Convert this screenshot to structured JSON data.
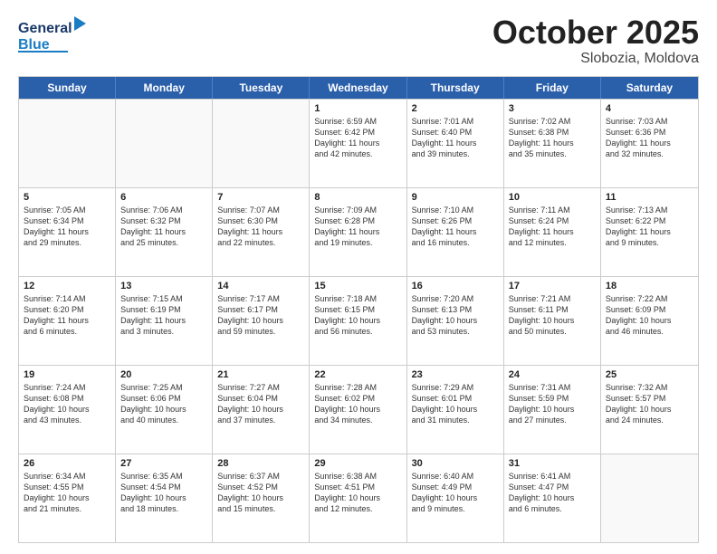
{
  "logo": {
    "line1": "General",
    "line2": "Blue"
  },
  "header": {
    "month": "October 2025",
    "location": "Slobozia, Moldova"
  },
  "weekdays": [
    "Sunday",
    "Monday",
    "Tuesday",
    "Wednesday",
    "Thursday",
    "Friday",
    "Saturday"
  ],
  "rows": [
    [
      {
        "day": "",
        "info": ""
      },
      {
        "day": "",
        "info": ""
      },
      {
        "day": "",
        "info": ""
      },
      {
        "day": "1",
        "info": "Sunrise: 6:59 AM\nSunset: 6:42 PM\nDaylight: 11 hours\nand 42 minutes."
      },
      {
        "day": "2",
        "info": "Sunrise: 7:01 AM\nSunset: 6:40 PM\nDaylight: 11 hours\nand 39 minutes."
      },
      {
        "day": "3",
        "info": "Sunrise: 7:02 AM\nSunset: 6:38 PM\nDaylight: 11 hours\nand 35 minutes."
      },
      {
        "day": "4",
        "info": "Sunrise: 7:03 AM\nSunset: 6:36 PM\nDaylight: 11 hours\nand 32 minutes."
      }
    ],
    [
      {
        "day": "5",
        "info": "Sunrise: 7:05 AM\nSunset: 6:34 PM\nDaylight: 11 hours\nand 29 minutes."
      },
      {
        "day": "6",
        "info": "Sunrise: 7:06 AM\nSunset: 6:32 PM\nDaylight: 11 hours\nand 25 minutes."
      },
      {
        "day": "7",
        "info": "Sunrise: 7:07 AM\nSunset: 6:30 PM\nDaylight: 11 hours\nand 22 minutes."
      },
      {
        "day": "8",
        "info": "Sunrise: 7:09 AM\nSunset: 6:28 PM\nDaylight: 11 hours\nand 19 minutes."
      },
      {
        "day": "9",
        "info": "Sunrise: 7:10 AM\nSunset: 6:26 PM\nDaylight: 11 hours\nand 16 minutes."
      },
      {
        "day": "10",
        "info": "Sunrise: 7:11 AM\nSunset: 6:24 PM\nDaylight: 11 hours\nand 12 minutes."
      },
      {
        "day": "11",
        "info": "Sunrise: 7:13 AM\nSunset: 6:22 PM\nDaylight: 11 hours\nand 9 minutes."
      }
    ],
    [
      {
        "day": "12",
        "info": "Sunrise: 7:14 AM\nSunset: 6:20 PM\nDaylight: 11 hours\nand 6 minutes."
      },
      {
        "day": "13",
        "info": "Sunrise: 7:15 AM\nSunset: 6:19 PM\nDaylight: 11 hours\nand 3 minutes."
      },
      {
        "day": "14",
        "info": "Sunrise: 7:17 AM\nSunset: 6:17 PM\nDaylight: 10 hours\nand 59 minutes."
      },
      {
        "day": "15",
        "info": "Sunrise: 7:18 AM\nSunset: 6:15 PM\nDaylight: 10 hours\nand 56 minutes."
      },
      {
        "day": "16",
        "info": "Sunrise: 7:20 AM\nSunset: 6:13 PM\nDaylight: 10 hours\nand 53 minutes."
      },
      {
        "day": "17",
        "info": "Sunrise: 7:21 AM\nSunset: 6:11 PM\nDaylight: 10 hours\nand 50 minutes."
      },
      {
        "day": "18",
        "info": "Sunrise: 7:22 AM\nSunset: 6:09 PM\nDaylight: 10 hours\nand 46 minutes."
      }
    ],
    [
      {
        "day": "19",
        "info": "Sunrise: 7:24 AM\nSunset: 6:08 PM\nDaylight: 10 hours\nand 43 minutes."
      },
      {
        "day": "20",
        "info": "Sunrise: 7:25 AM\nSunset: 6:06 PM\nDaylight: 10 hours\nand 40 minutes."
      },
      {
        "day": "21",
        "info": "Sunrise: 7:27 AM\nSunset: 6:04 PM\nDaylight: 10 hours\nand 37 minutes."
      },
      {
        "day": "22",
        "info": "Sunrise: 7:28 AM\nSunset: 6:02 PM\nDaylight: 10 hours\nand 34 minutes."
      },
      {
        "day": "23",
        "info": "Sunrise: 7:29 AM\nSunset: 6:01 PM\nDaylight: 10 hours\nand 31 minutes."
      },
      {
        "day": "24",
        "info": "Sunrise: 7:31 AM\nSunset: 5:59 PM\nDaylight: 10 hours\nand 27 minutes."
      },
      {
        "day": "25",
        "info": "Sunrise: 7:32 AM\nSunset: 5:57 PM\nDaylight: 10 hours\nand 24 minutes."
      }
    ],
    [
      {
        "day": "26",
        "info": "Sunrise: 6:34 AM\nSunset: 4:55 PM\nDaylight: 10 hours\nand 21 minutes."
      },
      {
        "day": "27",
        "info": "Sunrise: 6:35 AM\nSunset: 4:54 PM\nDaylight: 10 hours\nand 18 minutes."
      },
      {
        "day": "28",
        "info": "Sunrise: 6:37 AM\nSunset: 4:52 PM\nDaylight: 10 hours\nand 15 minutes."
      },
      {
        "day": "29",
        "info": "Sunrise: 6:38 AM\nSunset: 4:51 PM\nDaylight: 10 hours\nand 12 minutes."
      },
      {
        "day": "30",
        "info": "Sunrise: 6:40 AM\nSunset: 4:49 PM\nDaylight: 10 hours\nand 9 minutes."
      },
      {
        "day": "31",
        "info": "Sunrise: 6:41 AM\nSunset: 4:47 PM\nDaylight: 10 hours\nand 6 minutes."
      },
      {
        "day": "",
        "info": ""
      }
    ]
  ]
}
